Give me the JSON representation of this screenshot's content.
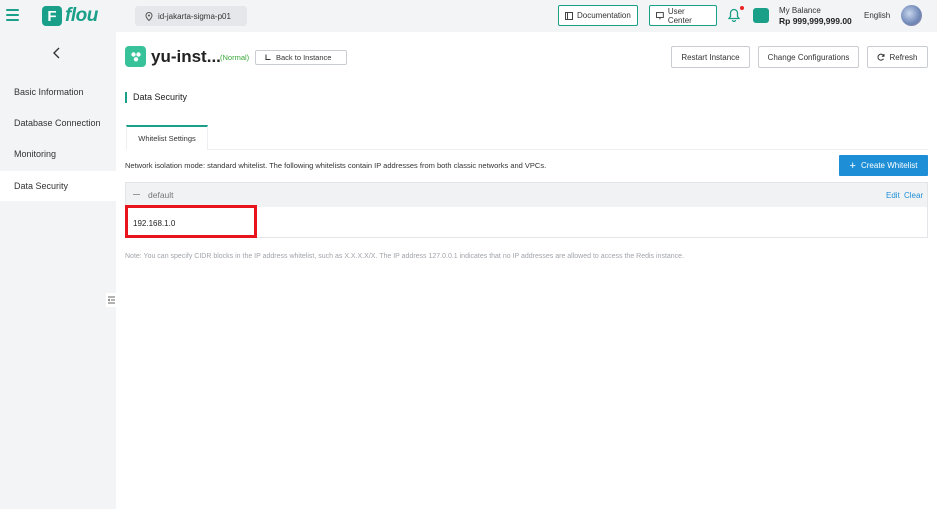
{
  "header": {
    "logo_mark": "F",
    "logo_text": "flou",
    "region": "id-jakarta-sigma-p01",
    "documentation_label": "Documentation",
    "user_center_label": "User Center",
    "balance_label": "My Balance",
    "balance_value": "Rp 999,999,999.00",
    "language": "English"
  },
  "sidebar": {
    "items": [
      {
        "label": "Basic Information"
      },
      {
        "label": "Database Connection"
      },
      {
        "label": "Monitoring"
      },
      {
        "label": "Data Security"
      }
    ],
    "active_index": 3
  },
  "instance": {
    "name": "yu-inst...",
    "status": "(Normal)",
    "back_label": "Back to Instance"
  },
  "actions": {
    "restart_label": "Restart Instance",
    "config_label": "Change Configurations",
    "refresh_label": "Refresh"
  },
  "section": {
    "title": "Data Security",
    "tab_label": "Whitelist Settings",
    "info": "Network isolation mode: standard whitelist. The following whitelists contain IP addresses from both classic networks and VPCs.",
    "create_label": "Create Whitelist"
  },
  "whitelist": {
    "name": "default",
    "edit_label": "Edit",
    "clear_label": "Clear",
    "ips": "192.168.1.0"
  },
  "note": "Note: You can specify CIDR blocks in the IP address whitelist, such as X.X.X.X/X. The IP address 127.0.0.1 indicates that no IP addresses are allowed to access the Redis instance.",
  "colors": {
    "brand": "#1aa088",
    "primary_button": "#1e8fd6",
    "highlight": "#e8141c",
    "status_normal": "#3aa63a"
  }
}
